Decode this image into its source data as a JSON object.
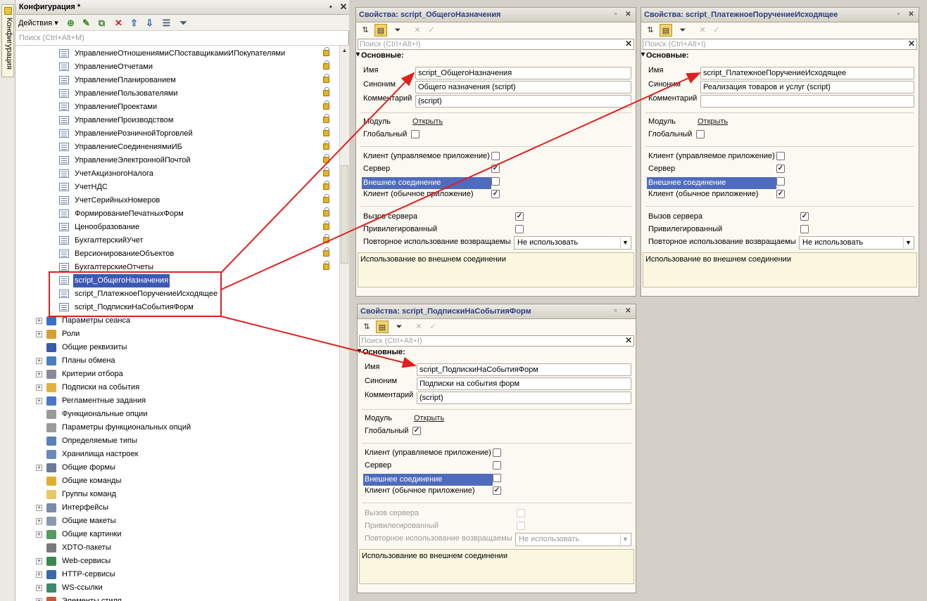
{
  "dock": {
    "label": "Конфигурация"
  },
  "config": {
    "title": "Конфигурация *",
    "actions_label": "Действия",
    "search_placeholder": "Поиск (Ctrl+Alt+M)",
    "modules": [
      "УправлениеОтношениямиСПоставщикамиИПокупателями",
      "УправлениеОтчетами",
      "УправлениеПланированием",
      "УправлениеПользователями",
      "УправлениеПроектами",
      "УправлениеПроизводством",
      "УправлениеРозничнойТорговлей",
      "УправлениеСоединениямиИБ",
      "УправлениеЭлектроннойПочтой",
      "УчетАкцизногоНалога",
      "УчетНДС",
      "УчетСерийныхНомеров",
      "ФормированиеПечатныхФорм",
      "Ценообразование",
      "БухгалтерскийУчет",
      "ВерсионированиеОбъектов",
      "БухгалтерскиеОтчеты"
    ],
    "script_modules": [
      "script_ОбщегоНазначения",
      "script_ПлатежноеПоручениеИсходящее",
      "script_ПодпискиНаСобытияФорм"
    ],
    "groups": [
      {
        "label": "Параметры сеанса",
        "expandable": true,
        "color": "#3a72c8"
      },
      {
        "label": "Роли",
        "expandable": true,
        "color": "#d8a030"
      },
      {
        "label": "Общие реквизиты",
        "expandable": false,
        "color": "#3a5aa8"
      },
      {
        "label": "Планы обмена",
        "expandable": true,
        "color": "#4a80c0"
      },
      {
        "label": "Критерии отбора",
        "expandable": true,
        "color": "#8a8a9a"
      },
      {
        "label": "Подписки на события",
        "expandable": true,
        "color": "#e0b040"
      },
      {
        "label": "Регламентные задания",
        "expandable": true,
        "color": "#4a78c8"
      },
      {
        "label": "Функциональные опции",
        "expandable": false,
        "color": "#9a9a9a"
      },
      {
        "label": "Параметры функциональных опций",
        "expandable": false,
        "color": "#9a9a9a"
      },
      {
        "label": "Определяемые типы",
        "expandable": false,
        "color": "#5a80b8"
      },
      {
        "label": "Хранилища настроек",
        "expandable": false,
        "color": "#6a8ab8"
      },
      {
        "label": "Общие формы",
        "expandable": true,
        "color": "#6a7a98"
      },
      {
        "label": "Общие команды",
        "expandable": false,
        "color": "#e0b030"
      },
      {
        "label": "Группы команд",
        "expandable": false,
        "color": "#e8c860"
      },
      {
        "label": "Интерфейсы",
        "expandable": true,
        "color": "#7a8aa8"
      },
      {
        "label": "Общие макеты",
        "expandable": true,
        "color": "#8a9ab0"
      },
      {
        "label": "Общие картинки",
        "expandable": true,
        "color": "#5a9a60"
      },
      {
        "label": "XDTO-пакеты",
        "expandable": false,
        "color": "#7a7a7a"
      },
      {
        "label": "Web-сервисы",
        "expandable": true,
        "color": "#3a8a50"
      },
      {
        "label": "HTTP-сервисы",
        "expandable": true,
        "color": "#3a6aa8"
      },
      {
        "label": "WS-ссылки",
        "expandable": true,
        "color": "#3a8a6a"
      },
      {
        "label": "Элементы стиля",
        "expandable": true,
        "color": "#c85a3a"
      }
    ]
  },
  "windows": {
    "w1": {
      "title": "Свойства: script_ОбщегоНазначения",
      "search_placeholder": "Поиск (Ctrl+Alt+I)",
      "group_label": "Основные:",
      "name_label": "Имя",
      "name_value": "script_ОбщегоНазначения",
      "synonym_label": "Синоним",
      "synonym_value": "Общего назначения (script)",
      "comment_label": "Комментарий",
      "comment_value": "(script)",
      "module_label": "Модуль",
      "open_link": "Открыть",
      "global_label": "Глобальный",
      "global_checked": "",
      "client_managed_label": "Клиент (управляемое приложение)",
      "client_managed_checked": "",
      "server_label": "Сервер",
      "server_checked": "✓",
      "external_label": "Внешнее соединение",
      "external_checked": "",
      "client_ordinary_label": "Клиент (обычное приложение)",
      "client_ordinary_checked": "✓",
      "server_call_label": "Вызов сервера",
      "server_call_checked": "✓",
      "privileged_label": "Привилегированный",
      "privileged_checked": "",
      "reuse_label": "Повторное использование возвращаемы",
      "reuse_value": "Не использовать",
      "description": "Использование во внешнем соединении"
    },
    "w2": {
      "title": "Свойства: script_ПлатежноеПоручениеИсходящее",
      "search_placeholder": "Поиск (Ctrl+Alt+I)",
      "group_label": "Основные:",
      "name_label": "Имя",
      "name_value": "script_ПлатежноеПоручениеИсходящее",
      "synonym_label": "Синоним",
      "synonym_value": "Реализация товаров и услуг (script)",
      "comment_label": "Комментарий",
      "comment_value": "",
      "module_label": "Модуль",
      "open_link": "Открыть",
      "global_label": "Глобальный",
      "global_checked": "",
      "client_managed_label": "Клиент (управляемое приложение)",
      "client_managed_checked": "",
      "server_label": "Сервер",
      "server_checked": "✓",
      "external_label": "Внешнее соединение",
      "external_checked": "",
      "client_ordinary_label": "Клиент (обычное приложение)",
      "client_ordinary_checked": "✓",
      "server_call_label": "Вызов сервера",
      "server_call_checked": "✓",
      "privileged_label": "Привилегированный",
      "privileged_checked": "",
      "reuse_label": "Повторное использование возвращаемы",
      "reuse_value": "Не использовать",
      "description": "Использование во внешнем соединении"
    },
    "w3": {
      "title": "Свойства: script_ПодпискиНаСобытияФорм",
      "search_placeholder": "Поиск (Ctrl+Alt+I)",
      "group_label": "Основные:",
      "name_label": "Имя",
      "name_value": "script_ПодпискиНаСобытияФорм",
      "synonym_label": "Синоним",
      "synonym_value": "Подписки на события форм",
      "comment_label": "Комментарий",
      "comment_value": "(script)",
      "module_label": "Модуль",
      "open_link": "Открыть",
      "global_label": "Глобальный",
      "global_checked": "✓",
      "client_managed_label": "Клиент (управляемое приложение)",
      "client_managed_checked": "",
      "server_label": "Сервер",
      "server_checked": "",
      "external_label": "Внешнее соединение",
      "external_checked": "",
      "client_ordinary_label": "Клиент (обычное приложение)",
      "client_ordinary_checked": "✓",
      "server_call_label": "Вызов сервера",
      "server_call_checked": "",
      "privileged_label": "Привилегированный",
      "privileged_checked": "",
      "reuse_label": "Повторное использование возвращаемы",
      "reuse_value": "Не использовать",
      "description": "Использование во внешнем соединении"
    }
  },
  "colors": {
    "selection": "#3c5ab4",
    "highlight": "#4f6bbd",
    "annotation": "#e02020"
  }
}
